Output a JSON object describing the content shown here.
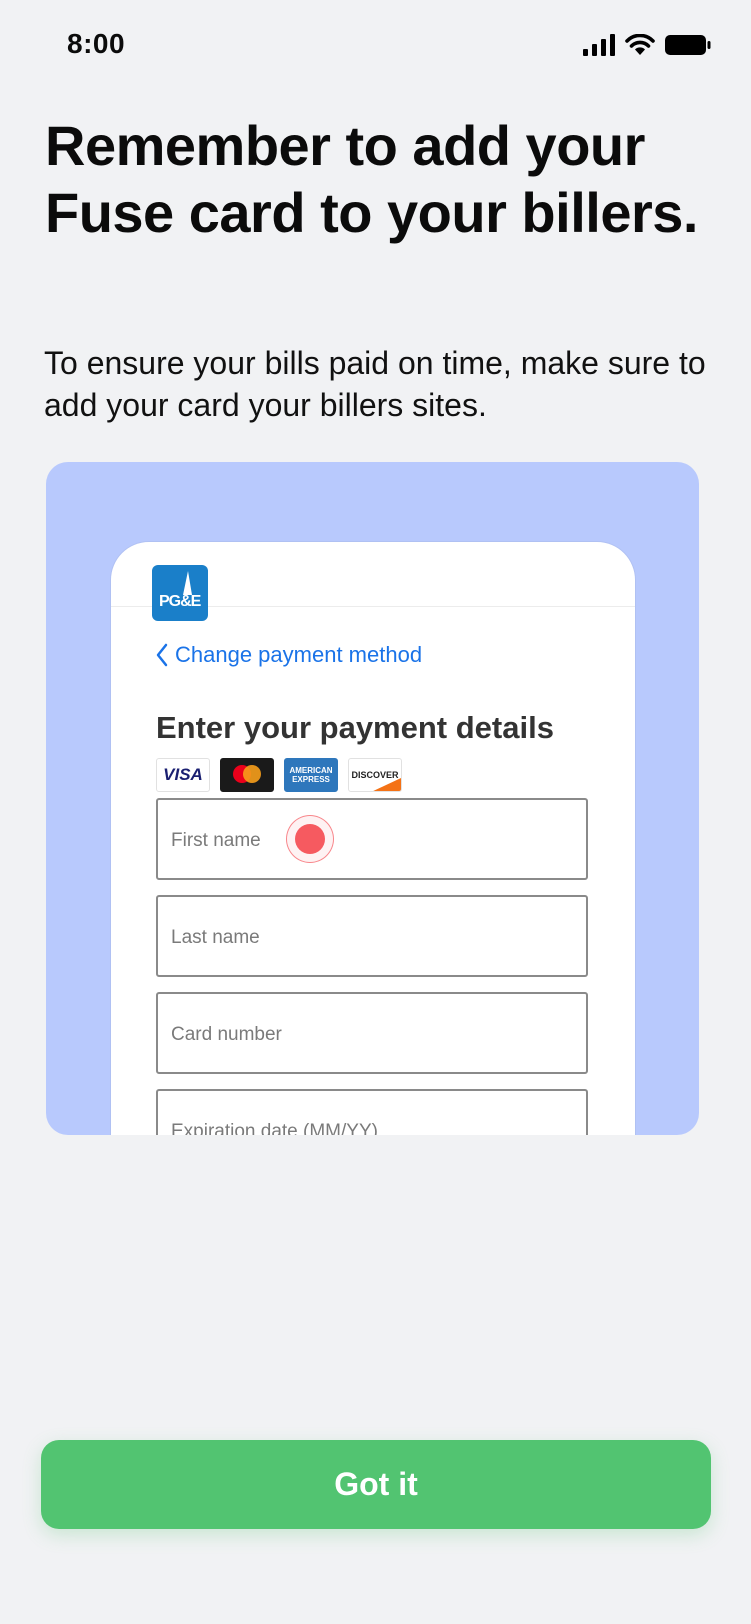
{
  "status_bar": {
    "time": "8:00"
  },
  "title": "Remember to add your Fuse card to your billers.",
  "subtitle": "To ensure your bills paid on time, make sure to add your card your billers sites.",
  "illustration": {
    "logo_text": "PG&E",
    "back_link": "Change payment method",
    "payment_title": "Enter your payment details",
    "card_brands": {
      "visa": "VISA",
      "amex_line1": "AMERICAN",
      "amex_line2": "EXPRESS",
      "discover": "DISCOVER"
    },
    "fields": [
      "First name",
      "Last name",
      "Card number",
      "Expiration date (MM/YY)"
    ]
  },
  "cta": {
    "label": "Got it"
  },
  "colors": {
    "accent": "#52c471",
    "illustration_bg": "#b8c9fd",
    "link": "#1a73e8",
    "tap": "#f65a60"
  }
}
